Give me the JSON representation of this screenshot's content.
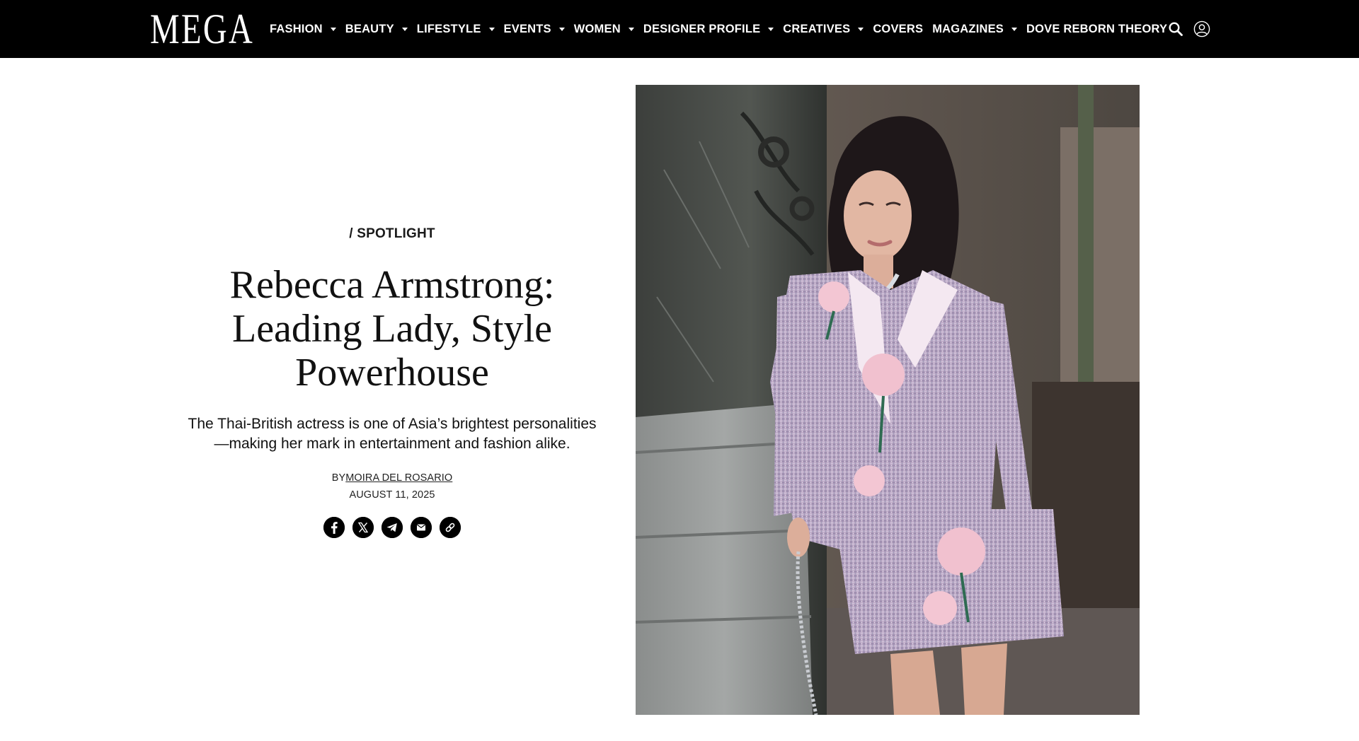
{
  "header": {
    "logo": "MEGA",
    "nav": [
      {
        "label": "FASHION",
        "dropdown": true
      },
      {
        "label": "BEAUTY",
        "dropdown": true
      },
      {
        "label": "LIFESTYLE",
        "dropdown": true
      },
      {
        "label": "EVENTS",
        "dropdown": true
      },
      {
        "label": "WOMEN",
        "dropdown": true
      },
      {
        "label": "DESIGNER PROFILE",
        "dropdown": true
      },
      {
        "label": "CREATIVES",
        "dropdown": true
      },
      {
        "label": "COVERS",
        "dropdown": false
      },
      {
        "label": "MAGAZINES",
        "dropdown": true
      },
      {
        "label": "DOVE REBORN THEORY",
        "dropdown": false
      }
    ],
    "icons": [
      "search-icon",
      "user-account-icon"
    ]
  },
  "article": {
    "category": "/ SPOTLIGHT",
    "title": "Rebecca Armstrong: Leading Lady, Style Powerhouse",
    "dek": "The Thai-British actress is one of Asia’s brightest personalities—making her mark in entertainment and fashion alike.",
    "byline_prefix": "BY",
    "author": "MOIRA DEL ROSARIO",
    "date": "AUGUST 11, 2025",
    "share_icons": [
      "facebook-icon",
      "x-icon",
      "telegram-icon",
      "email-icon",
      "link-icon"
    ]
  },
  "colors": {
    "nav_bg": "#000000",
    "nav_text": "#ffffff",
    "body_bg": "#ffffff",
    "text": "#111111",
    "share_bg": "#000000"
  }
}
